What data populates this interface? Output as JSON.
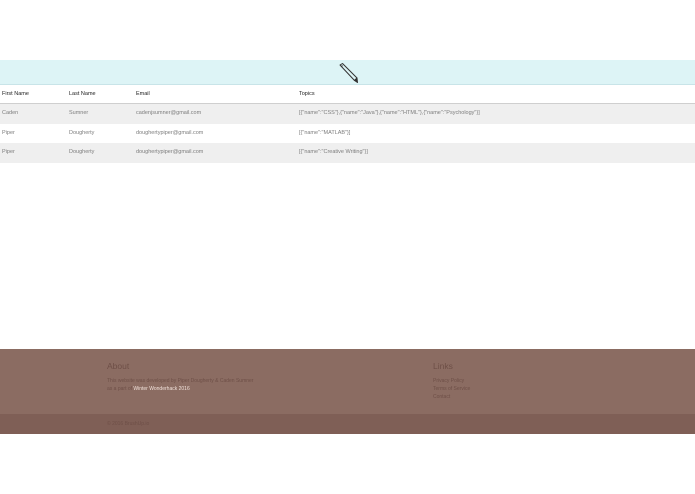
{
  "edit_icon": "pencil-icon",
  "table": {
    "headers": [
      "First Name",
      "Last Name",
      "Email",
      "Topics"
    ],
    "rows": [
      [
        "Caden",
        "Sumner",
        "cadenjsumner@gmail.com",
        "[{\"name\":\"CSS\"},{\"name\":\"Java\"},{\"name\":\"HTML\"},{\"name\":\"Psychology\"}]"
      ],
      [
        "Piper",
        "Dougherty",
        "doughertypiper@gmail.com",
        "[{\"name\":\"MATLAB\"}]"
      ],
      [
        "Piper",
        "Dougherty",
        "doughertypiper@gmail.com",
        "[{\"name\":\"Creative Writing\"}]"
      ]
    ]
  },
  "footer": {
    "about_title": "About",
    "about_line1": "This website was developed by Piper Dougherty & Caden Sumner",
    "about_line2_prefix": "as a part of",
    "about_link": "Winter Wonderhack 2016",
    "links_title": "Links",
    "links": [
      "Privacy Policy",
      "Terms of Service",
      "Contact"
    ],
    "copyright": "© 2016 BrushUp.io"
  },
  "colors": {
    "edit_band": "#ddf4f6",
    "footer": "#8b6c62",
    "footer_bottom": "#7f5f56",
    "row_alt": "#efefef"
  }
}
